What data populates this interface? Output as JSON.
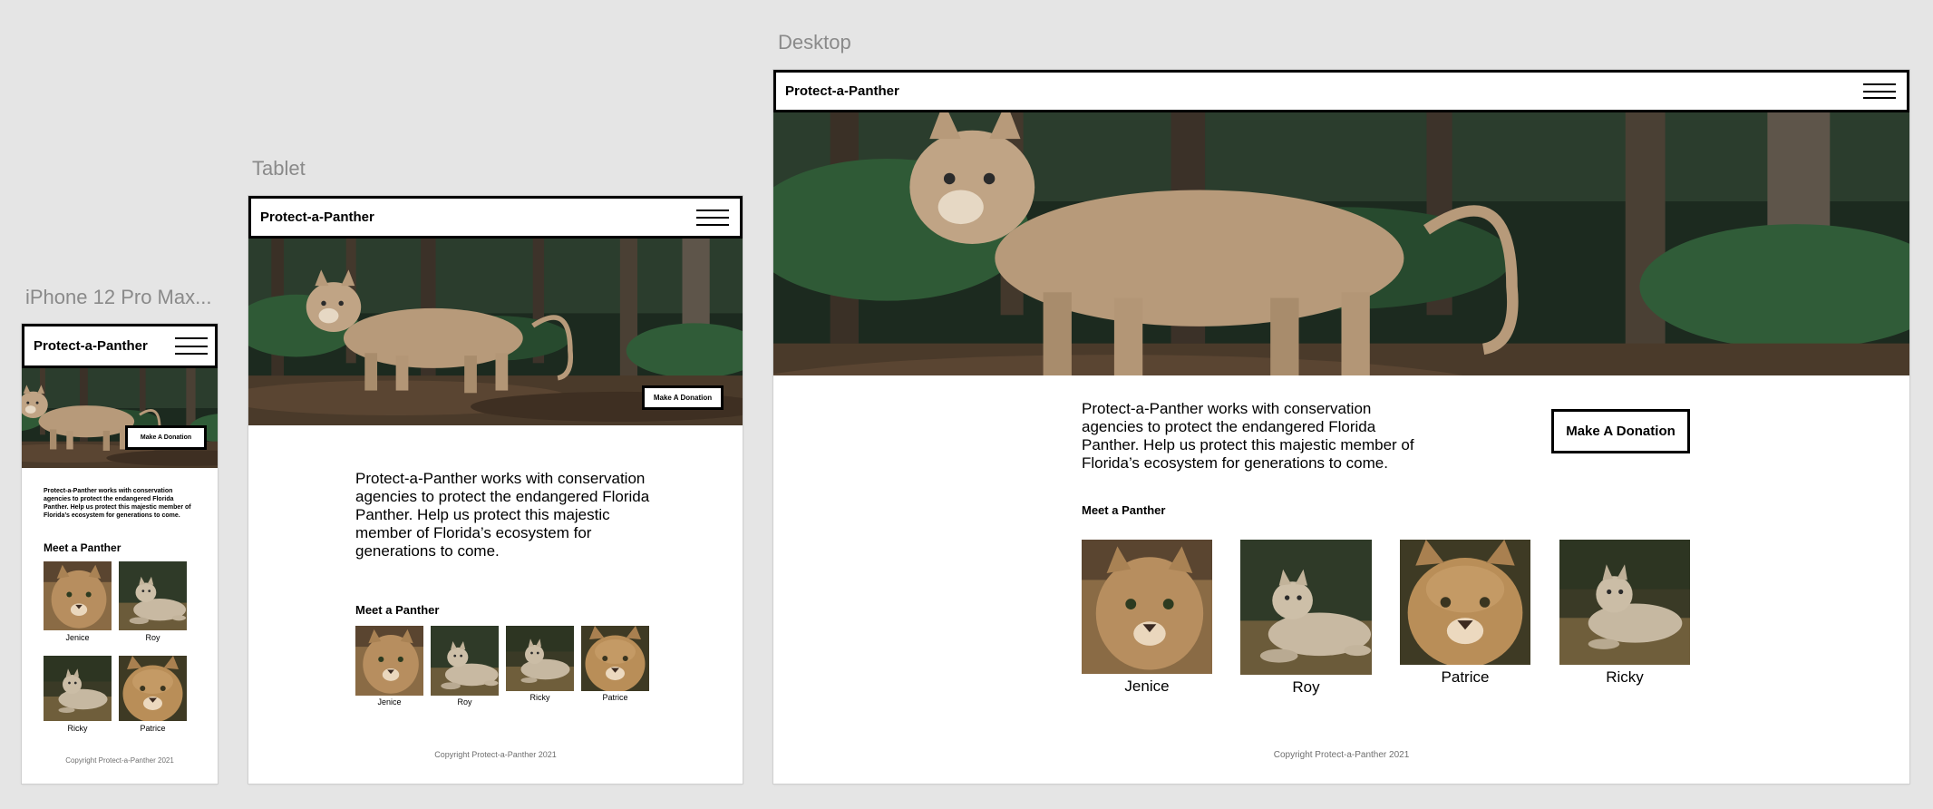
{
  "artboards": {
    "phone": {
      "title": "iPhone 12 Pro Max..."
    },
    "tablet": {
      "title": "Tablet"
    },
    "desktop": {
      "title": "Desktop"
    }
  },
  "site": {
    "brand": "Protect-a-Panther",
    "donate_label": "Make A Donation",
    "mission": "Protect-a-Panther works with conservation agencies to protect the endangered Florida Panther. Help us protect this majestic member of Florida’s ecosystem for generations to come.",
    "meet_heading": "Meet a Panther",
    "copyright": "Copyright Protect-a-Panther 2021"
  },
  "panthers": {
    "jenice": "Jenice",
    "roy": "Roy",
    "patrice": "Patrice",
    "ricky": "Ricky"
  },
  "icons": {
    "menu": "hamburger-menu-icon"
  },
  "colors": {
    "canvas_bg": "#e5e5e5",
    "frame_border": "#000000",
    "panther_fur": "#b79a7a",
    "forest_dark": "#1f2b1c"
  }
}
